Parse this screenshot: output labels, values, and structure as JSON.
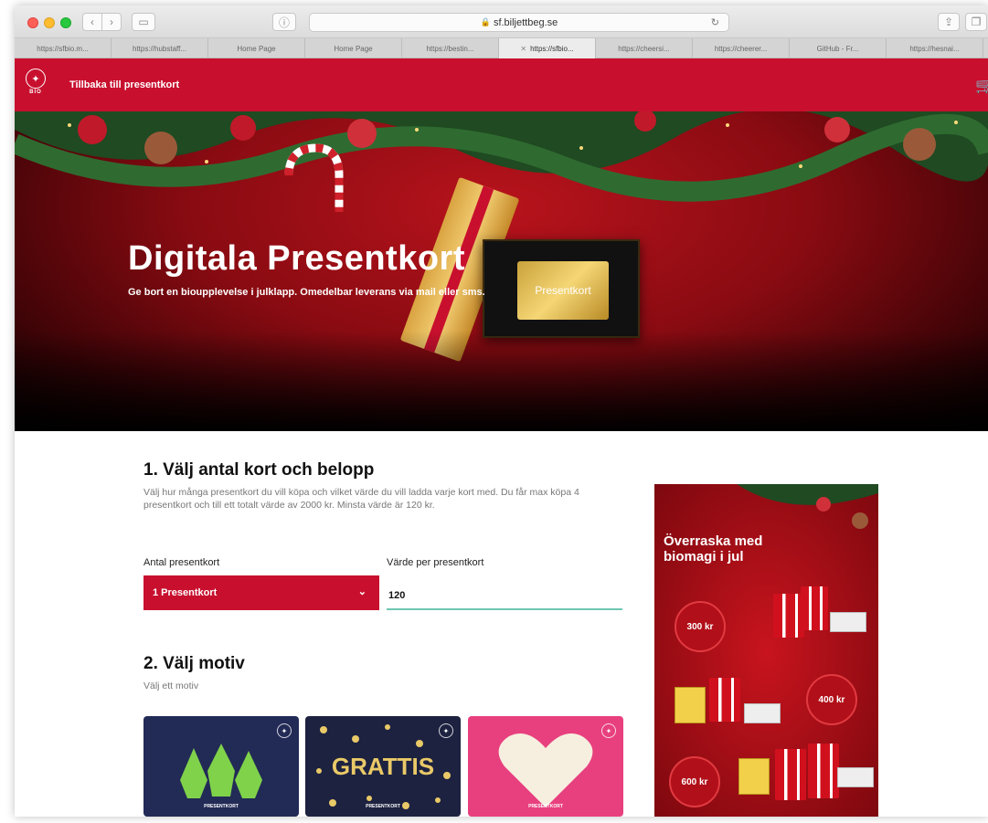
{
  "browser": {
    "url": "sf.biljettbeg.se",
    "tabs": [
      "https://sfbio.m...",
      "https://hubstaff...",
      "Home Page",
      "Home Page",
      "https://bestin...",
      "https://sfbio...",
      "https://cheersi...",
      "https://cheerer...",
      "GitHub - Fr...",
      "https://hesnai..."
    ],
    "active_tab_index": 5
  },
  "header": {
    "logo_text": "BIO",
    "back_link": "Tillbaka till presentkort"
  },
  "hero": {
    "title": "Digitala Presentkort",
    "subtitle": "Ge bort en bioupplevelse i julklapp. Omedelbar leverans via mail eller sms.",
    "card_label": "Presentkort"
  },
  "step1": {
    "heading": "1. Välj antal kort och belopp",
    "description": "Välj hur många presentkort du vill köpa och vilket värde du vill ladda varje kort med. Du får max köpa 4 presentkort och till ett totalt värde av 2000 kr. Minsta värde är 120 kr.",
    "quantity_label": "Antal presentkort",
    "quantity_value": "1 Presentkort",
    "value_label": "Värde per presentkort",
    "value_input": "120"
  },
  "step2": {
    "heading": "2. Välj motiv",
    "description": "Välj ett motiv",
    "motifs": [
      {
        "caption": "PRESENTKORT",
        "big": ""
      },
      {
        "caption": "PRESENTKORT",
        "big": "GRATTIS"
      },
      {
        "caption": "PRESENTKORT",
        "big": ""
      }
    ]
  },
  "promo": {
    "title": "Överraska med biomagi i jul",
    "prices": [
      "300 kr",
      "400 kr",
      "600 kr"
    ]
  },
  "colors": {
    "brand_red": "#c8102e",
    "input_underline": "#6fc7b3"
  }
}
